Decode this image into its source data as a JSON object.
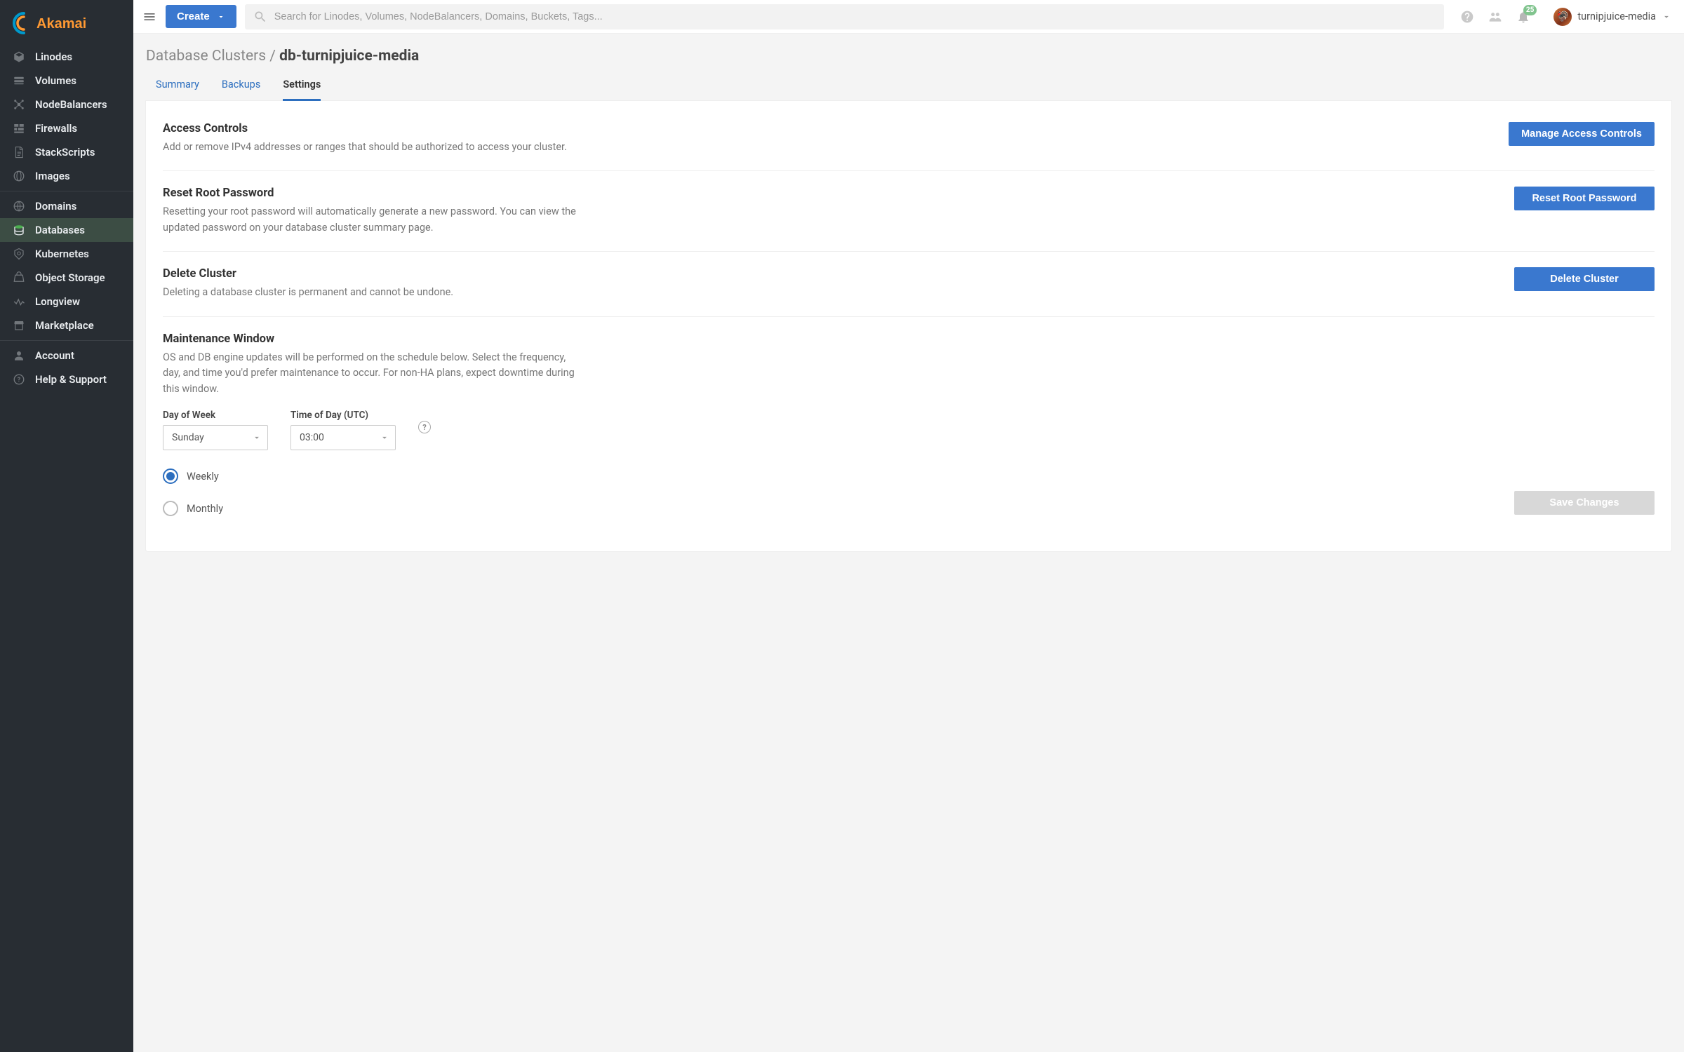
{
  "brand": "Akamai",
  "topbar": {
    "create_label": "Create",
    "search_placeholder": "Search for Linodes, Volumes, NodeBalancers, Domains, Buckets, Tags...",
    "notification_count": "25",
    "username": "turnipjuice-media"
  },
  "sidebar": {
    "groups": [
      [
        "Linodes",
        "Volumes",
        "NodeBalancers",
        "Firewalls",
        "StackScripts",
        "Images"
      ],
      [
        "Domains",
        "Databases",
        "Kubernetes",
        "Object Storage",
        "Longview",
        "Marketplace"
      ],
      [
        "Account",
        "Help & Support"
      ]
    ],
    "active": "Databases"
  },
  "breadcrumb": {
    "parent": "Database Clusters",
    "current": "db-turnipjuice-media"
  },
  "tabs": {
    "items": [
      "Summary",
      "Backups",
      "Settings"
    ],
    "active": "Settings"
  },
  "sections": {
    "access": {
      "title": "Access Controls",
      "desc": "Add or remove IPv4 addresses or ranges that should be authorized to access your cluster.",
      "button": "Manage Access Controls"
    },
    "reset": {
      "title": "Reset Root Password",
      "desc": "Resetting your root password will automatically generate a new password. You can view the updated password on your database cluster summary page.",
      "button": "Reset Root Password"
    },
    "delete": {
      "title": "Delete Cluster",
      "desc": "Deleting a database cluster is permanent and cannot be undone.",
      "button": "Delete Cluster"
    },
    "maintenance": {
      "title": "Maintenance Window",
      "desc": "OS and DB engine updates will be performed on the schedule below. Select the frequency, day, and time you'd prefer maintenance to occur. For non-HA plans, expect downtime during this window.",
      "day_label": "Day of Week",
      "time_label": "Time of Day (UTC)",
      "day_value": "Sunday",
      "time_value": "03:00",
      "freq_weekly": "Weekly",
      "freq_monthly": "Monthly",
      "freq_selected": "Weekly",
      "save_label": "Save Changes"
    }
  }
}
